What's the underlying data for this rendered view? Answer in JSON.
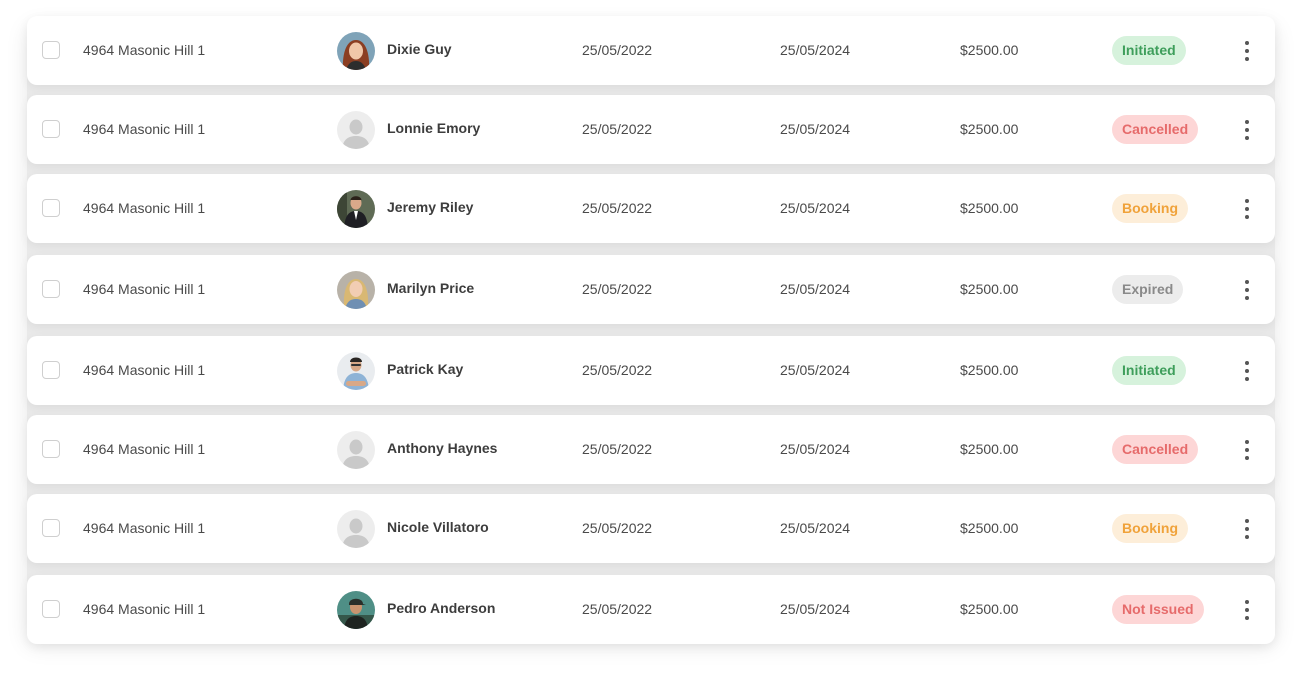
{
  "rows": [
    {
      "address": "4964 Masonic Hill 1",
      "tenant": "Dixie Guy",
      "avatar": "photo-woman-red-hair",
      "start_date": "25/05/2022",
      "end_date": "25/05/2024",
      "amount": "$2500.00",
      "status": "Initiated",
      "status_type": "initiated"
    },
    {
      "address": "4964 Masonic Hill 1",
      "tenant": "Lonnie Emory",
      "avatar": "placeholder-person",
      "start_date": "25/05/2022",
      "end_date": "25/05/2024",
      "amount": "$2500.00",
      "status": "Cancelled",
      "status_type": "cancelled"
    },
    {
      "address": "4964 Masonic Hill 1",
      "tenant": "Jeremy Riley",
      "avatar": "photo-man-suit",
      "start_date": "25/05/2022",
      "end_date": "25/05/2024",
      "amount": "$2500.00",
      "status": "Booking",
      "status_type": "booking"
    },
    {
      "address": "4964 Masonic Hill 1",
      "tenant": "Marilyn Price",
      "avatar": "photo-woman-blonde",
      "start_date": "25/05/2022",
      "end_date": "25/05/2024",
      "amount": "$2500.00",
      "status": "Expired",
      "status_type": "expired"
    },
    {
      "address": "4964 Masonic Hill 1",
      "tenant": "Patrick Kay",
      "avatar": "photo-man-arms-crossed",
      "start_date": "25/05/2022",
      "end_date": "25/05/2024",
      "amount": "$2500.00",
      "status": "Initiated",
      "status_type": "initiated"
    },
    {
      "address": "4964 Masonic Hill 1",
      "tenant": "Anthony Haynes",
      "avatar": "placeholder-person",
      "start_date": "25/05/2022",
      "end_date": "25/05/2024",
      "amount": "$2500.00",
      "status": "Cancelled",
      "status_type": "cancelled"
    },
    {
      "address": "4964 Masonic Hill 1",
      "tenant": "Nicole Villatoro",
      "avatar": "placeholder-person",
      "start_date": "25/05/2022",
      "end_date": "25/05/2024",
      "amount": "$2500.00",
      "status": "Booking",
      "status_type": "booking"
    },
    {
      "address": "4964 Masonic Hill 1",
      "tenant": "Pedro Anderson",
      "avatar": "photo-man-cap-outdoors",
      "start_date": "25/05/2022",
      "end_date": "25/05/2024",
      "amount": "$2500.00",
      "status": "Not Issued",
      "status_type": "not-issued"
    }
  ],
  "colors": {
    "initiated_bg": "#d6f2dc",
    "initiated_text": "#3e9e5b",
    "cancelled_bg": "#fdd6d6",
    "cancelled_text": "#e66b6b",
    "booking_bg": "#fdeed9",
    "booking_text": "#f0a23a",
    "expired_bg": "#ececec",
    "expired_text": "#8a8a8a"
  },
  "icons": {
    "row_menu": "more-vertical-icon"
  }
}
